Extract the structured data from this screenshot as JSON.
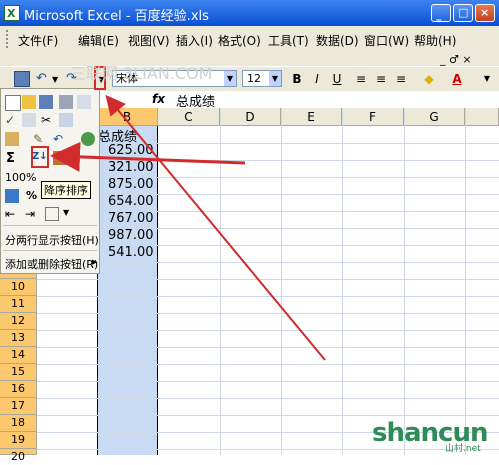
{
  "window": {
    "title": "Microsoft Excel - 百度经验.xls"
  },
  "menu": [
    "文件(F)",
    "编辑(E)",
    "视图(V)",
    "插入(I)",
    "格式(O)",
    "工具(T)",
    "数据(D)",
    "窗口(W)",
    "帮助(H)"
  ],
  "mdi_controls": "_ ♂ ×",
  "toolbar": {
    "font": "宋体",
    "size": "12",
    "bold": "B",
    "italic": "I",
    "underline": "U",
    "font_color_label": "A"
  },
  "formula": {
    "fx": "fx",
    "value": "总成绩"
  },
  "columns": [
    "B",
    "C",
    "D",
    "E",
    "F",
    "G"
  ],
  "rows": [
    "10",
    "11",
    "12",
    "13",
    "14",
    "15",
    "16",
    "17",
    "18",
    "19",
    "20"
  ],
  "cells": {
    "header": "总成绩",
    "values": [
      "625.00",
      "321.00",
      "875.00",
      "654.00",
      "767.00",
      "987.00",
      "541.00"
    ]
  },
  "panel": {
    "zoom": "100%",
    "pct": "%",
    "sum_glyph": "Σ",
    "tooltip": "降序排序",
    "split_label": "分两行显示按钮(H)",
    "add_remove_label": "添加或删除按钮(R)"
  },
  "watermark": {
    "text": "shancun",
    "sub": "山村.net",
    "faint": "三联网 3LIAN.COM"
  },
  "colors": {
    "title_bar": "#0a4fd4",
    "row_header": "#fbc86e",
    "selected_col": "#c9daf3",
    "annotation": "#d12b2b"
  }
}
